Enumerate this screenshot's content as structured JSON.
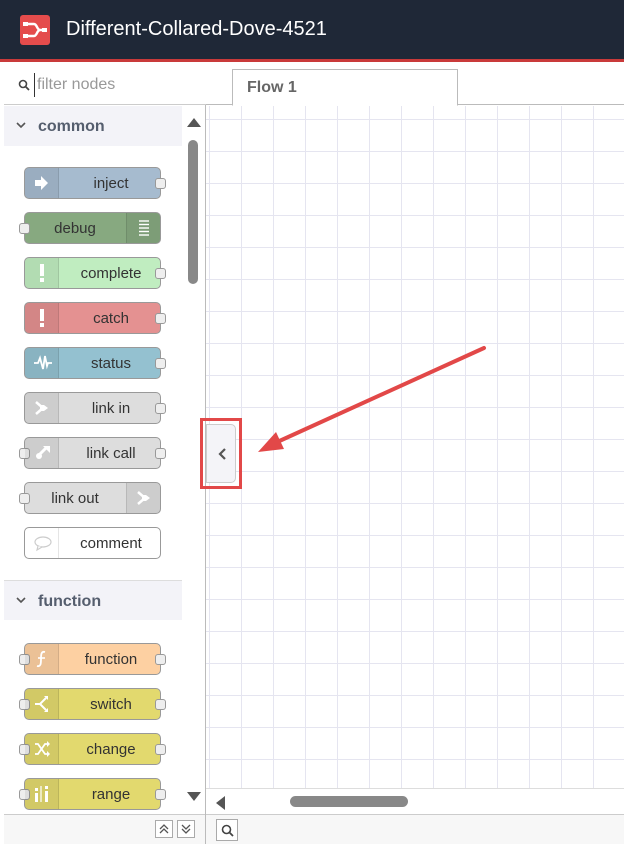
{
  "header": {
    "title": "Different-Collared-Dove-4521"
  },
  "palette": {
    "search_placeholder": "filter nodes",
    "categories": [
      {
        "label": "common",
        "nodes": [
          {
            "label": "inject",
            "color": "#a6bbcf",
            "icon": "arrow-in-icon"
          },
          {
            "label": "debug",
            "color": "#87a980",
            "icon": "list-icon"
          },
          {
            "label": "complete",
            "color": "#c0edc0",
            "icon": "exclamation-icon"
          },
          {
            "label": "catch",
            "color": "#e49191",
            "icon": "exclamation-icon"
          },
          {
            "label": "status",
            "color": "#94c1d0",
            "icon": "pulse-icon"
          },
          {
            "label": "link in",
            "color": "#dddddd",
            "icon": "link-in-icon"
          },
          {
            "label": "link call",
            "color": "#dddddd",
            "icon": "link-call-icon"
          },
          {
            "label": "link out",
            "color": "#dddddd",
            "icon": "link-out-icon"
          },
          {
            "label": "comment",
            "color": "#ffffff",
            "icon": "comment-icon"
          }
        ]
      },
      {
        "label": "function",
        "nodes": [
          {
            "label": "function",
            "color": "#fdd0a2",
            "icon": "function-icon"
          },
          {
            "label": "switch",
            "color": "#e2d96e",
            "icon": "switch-icon"
          },
          {
            "label": "change",
            "color": "#e2d96e",
            "icon": "shuffle-icon"
          },
          {
            "label": "range",
            "color": "#e2d96e",
            "icon": "range-icon"
          }
        ]
      }
    ]
  },
  "workspace": {
    "tabs": [
      {
        "label": "Flow 1"
      }
    ]
  },
  "colors": {
    "header_bg": "#1f2837",
    "accent_red": "#e24848",
    "grid_line": "#e5e5f0"
  }
}
